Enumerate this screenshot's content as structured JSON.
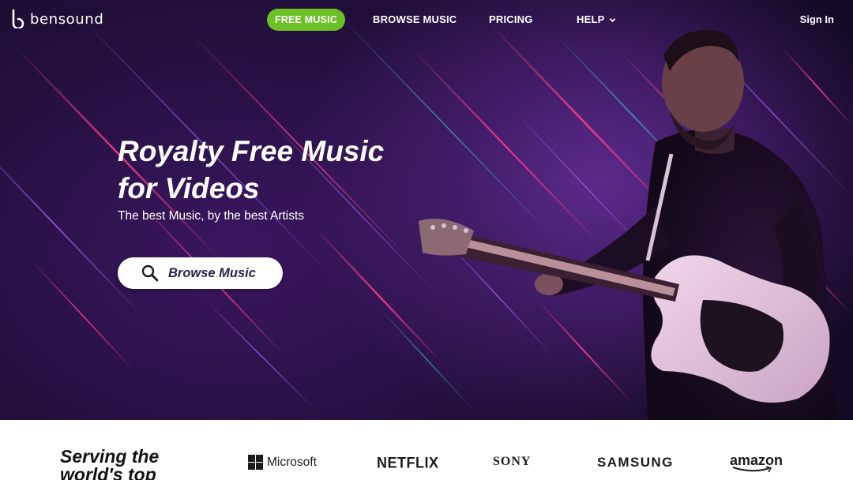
{
  "brand": {
    "name": "bensound",
    "logo_icon": "bensound-b-logo-icon"
  },
  "nav": {
    "items": [
      {
        "label": "FREE MUSIC",
        "active": true,
        "accent": "#6dbf26"
      },
      {
        "label": "BROWSE MUSIC"
      },
      {
        "label": "PRICING"
      },
      {
        "label": "HELP",
        "icon": "chevron-down-icon"
      }
    ],
    "sign_in": "Sign In"
  },
  "hero": {
    "title_line1": "Royalty Free Music",
    "title_line2": "for Videos",
    "subtitle": "The best Music, by the best Artists",
    "cta_label": "Browse Music",
    "cta_icon": "search-icon"
  },
  "clients": {
    "heading": "Serving the world's top",
    "logos": [
      "Microsoft",
      "NETFLIX",
      "SONY",
      "SAMSUNG",
      "amazon"
    ]
  },
  "colors": {
    "hero_bg": "#1a0b30",
    "accent_green": "#6dbf26",
    "streak_pink": "#e0327a",
    "streak_purple": "#a64dff"
  }
}
